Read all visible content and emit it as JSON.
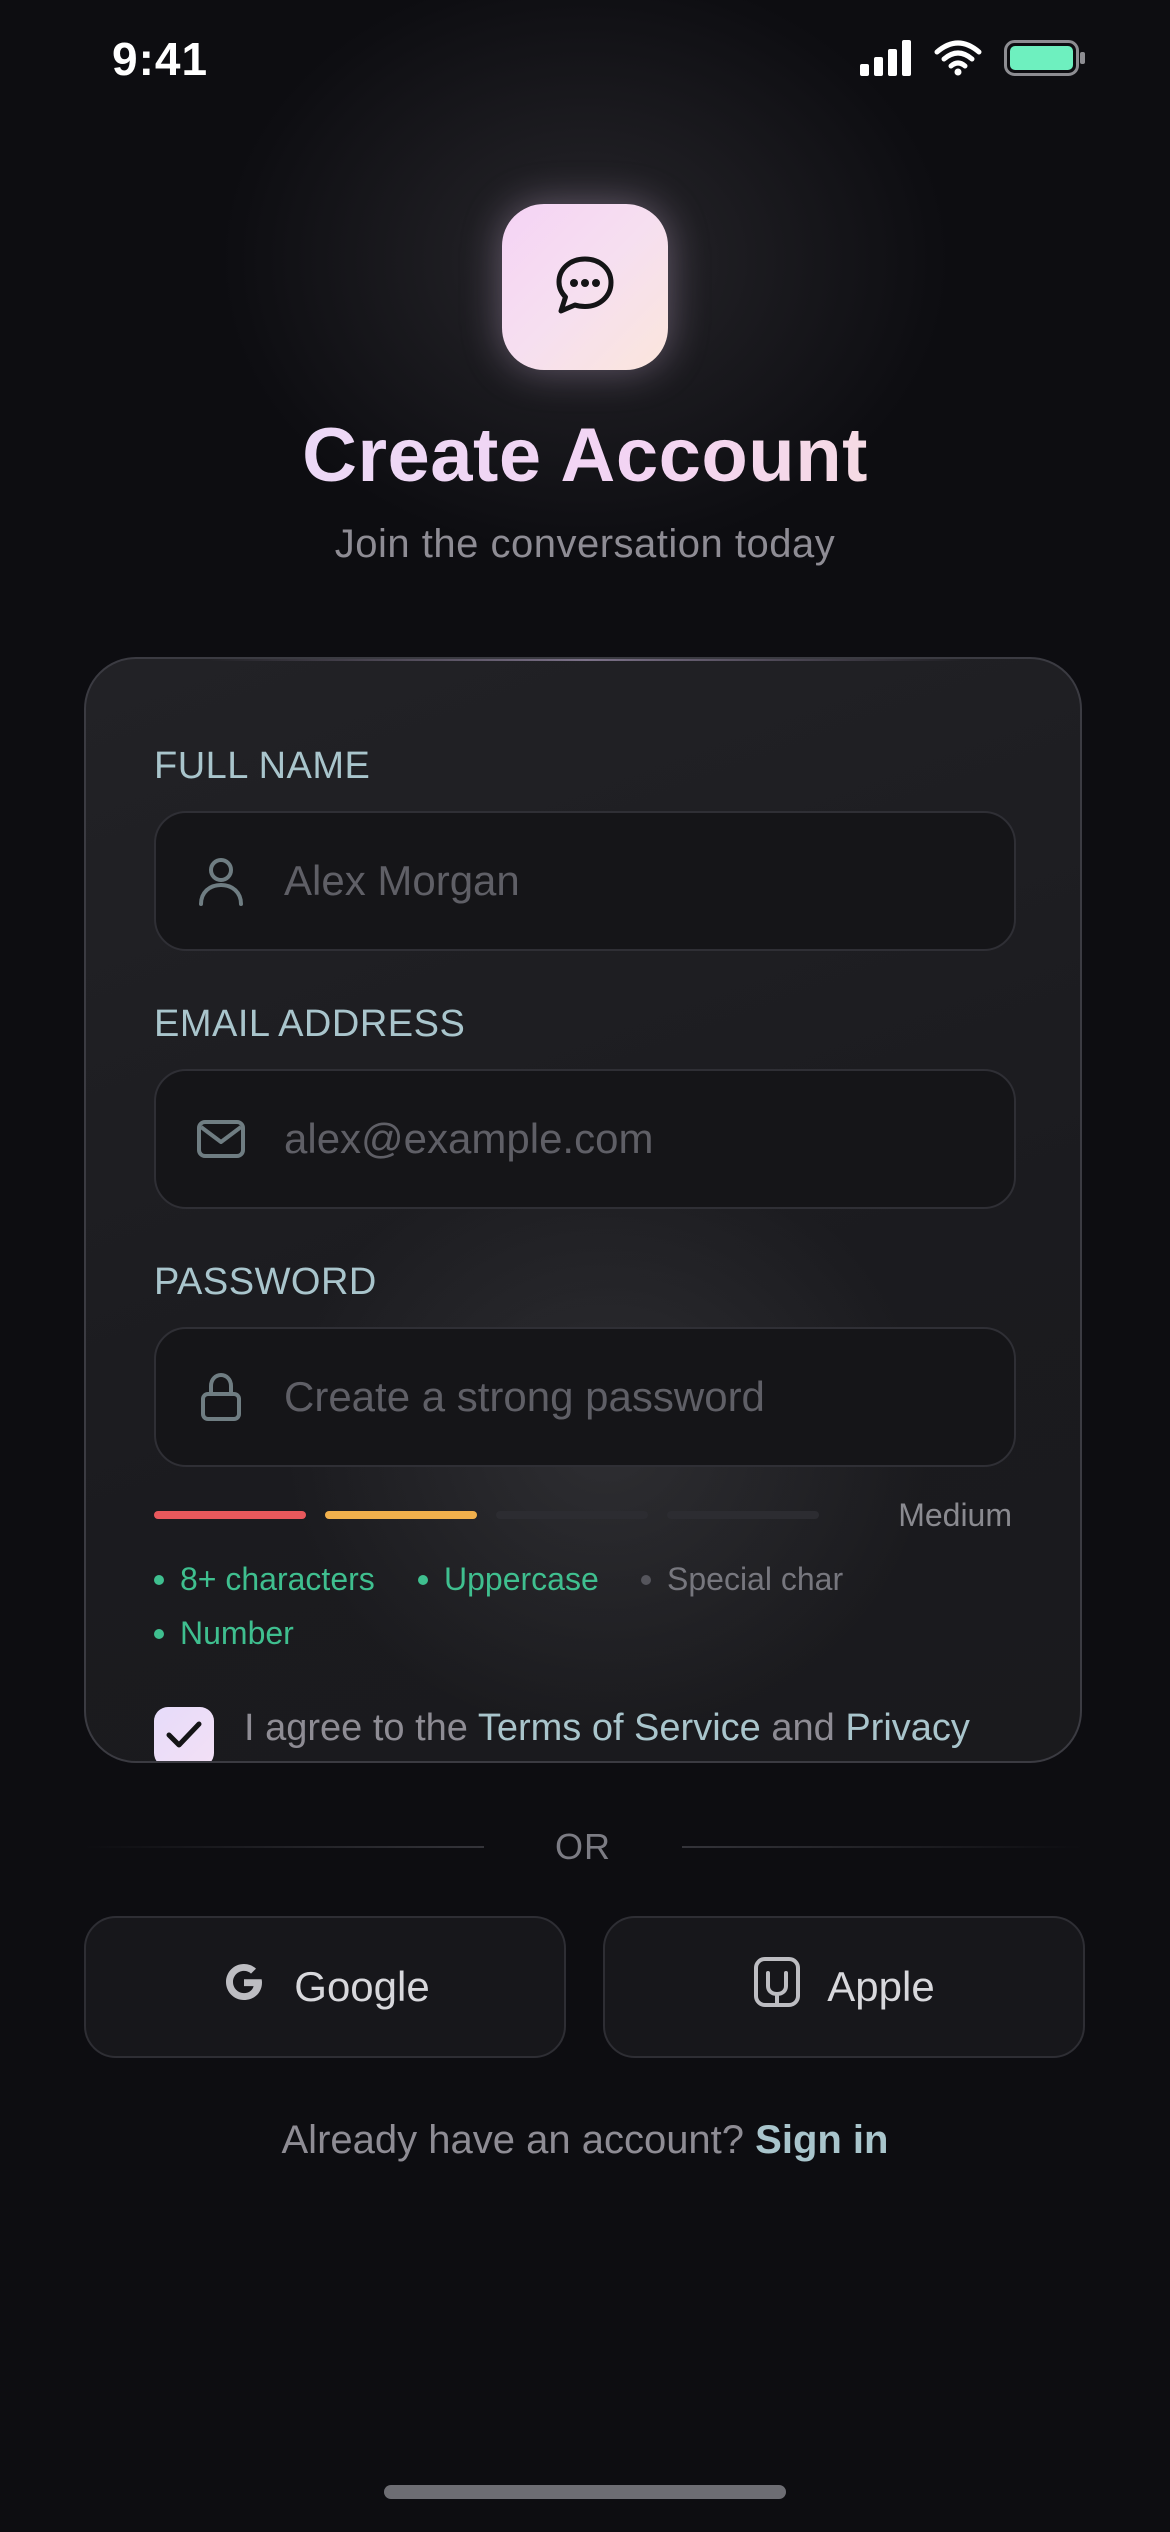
{
  "status_bar": {
    "time": "9:41"
  },
  "header": {
    "title": "Create Account",
    "subtitle": "Join the conversation today",
    "logo_icon": "chat-bubble-icon"
  },
  "form": {
    "full_name": {
      "label": "FULL NAME",
      "placeholder": "Alex Morgan",
      "value": "",
      "icon": "user-icon"
    },
    "email": {
      "label": "EMAIL ADDRESS",
      "placeholder": "alex@example.com",
      "value": "",
      "icon": "mail-icon"
    },
    "password": {
      "label": "PASSWORD",
      "placeholder": "Create a strong password",
      "value": "",
      "icon": "lock-icon"
    },
    "strength": {
      "label": "Medium",
      "level": 2,
      "segments": 4,
      "colors": [
        "#e8585c",
        "#f1b04c",
        "#2c2c31",
        "#2c2c31"
      ]
    },
    "requirements": [
      {
        "text": "8+ characters",
        "met": true
      },
      {
        "text": "Uppercase",
        "met": true
      },
      {
        "text": "Special char",
        "met": false
      },
      {
        "text": "Number",
        "met": true
      }
    ],
    "agreement": {
      "checked": true,
      "prefix": "I agree to the ",
      "terms_link": "Terms of Service",
      "middle": " and ",
      "privacy_link": "Privacy"
    }
  },
  "divider": {
    "label": "OR"
  },
  "social": {
    "google": {
      "label": "Google",
      "icon": "google-icon"
    },
    "apple": {
      "label": "Apple",
      "icon": "apple-icon"
    }
  },
  "footer": {
    "prompt": "Already have an account? ",
    "signin_label": "Sign in"
  },
  "colors": {
    "accent": "#a9c5cc",
    "success": "#3fbf8f",
    "background": "#0d0d11"
  }
}
